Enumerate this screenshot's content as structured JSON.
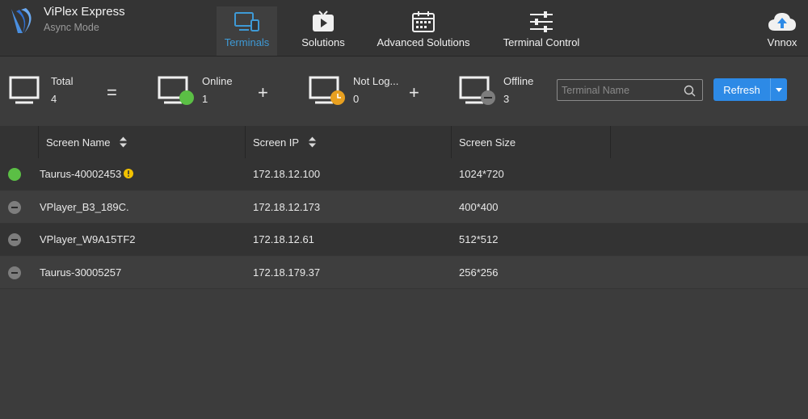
{
  "app": {
    "title": "ViPlex Express",
    "subtitle": "Async Mode"
  },
  "nav": {
    "tabs": [
      {
        "label": "Terminals",
        "icon": "terminals-icon",
        "active": true
      },
      {
        "label": "Solutions",
        "icon": "solutions-play-icon"
      },
      {
        "label": "Advanced Solutions",
        "icon": "calendar-icon"
      },
      {
        "label": "Terminal Control",
        "icon": "sliders-icon"
      }
    ],
    "cloud": {
      "label": "Vnnox",
      "icon": "cloud-upload-icon"
    }
  },
  "stats": {
    "total": {
      "label": "Total",
      "count": "4"
    },
    "online": {
      "label": "Online",
      "count": "1"
    },
    "not_logged": {
      "label": "Not Log...",
      "count": "0"
    },
    "offline": {
      "label": "Offline",
      "count": "3"
    },
    "equals": "=",
    "plus": "+"
  },
  "search": {
    "placeholder": "Terminal Name",
    "value": ""
  },
  "refresh": {
    "label": "Refresh"
  },
  "table": {
    "columns": [
      "Screen Name",
      "Screen IP",
      "Screen Size"
    ],
    "rows": [
      {
        "status": "online",
        "name": "Taurus-40002453",
        "warning": true,
        "ip": "172.18.12.100",
        "size": "1024*720"
      },
      {
        "status": "offline",
        "name": "VPlayer_B3_189C.",
        "warning": false,
        "ip": "172.18.12.173",
        "size": "400*400"
      },
      {
        "status": "offline",
        "name": "VPlayer_W9A15TF2",
        "warning": false,
        "ip": "172.18.12.61",
        "size": "512*512"
      },
      {
        "status": "offline",
        "name": "Taurus-30005257",
        "warning": false,
        "ip": "172.18.179.37",
        "size": "256*256"
      }
    ]
  },
  "colors": {
    "accent": "#2d8ae6",
    "active_tab_text": "#3e9ad6",
    "online": "#5bbf45",
    "not_logged": "#e8a020",
    "offline": "#7d7d7d",
    "warning": "#f2c200"
  }
}
